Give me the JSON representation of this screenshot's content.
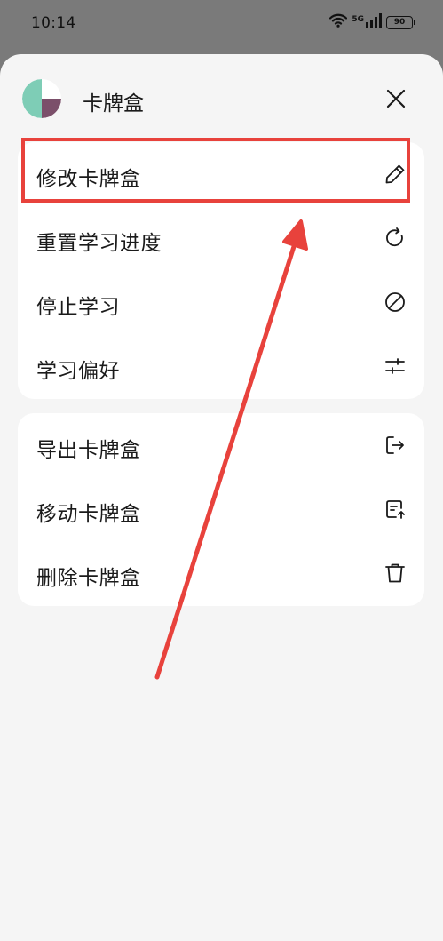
{
  "status_bar": {
    "time": "10:14",
    "network": "5G",
    "battery": "90"
  },
  "sheet": {
    "title": "卡牌盒",
    "avatar_colors": [
      "#7ecdb6",
      "#7b4f6a",
      "#ffffff"
    ]
  },
  "menu_group_1": [
    {
      "label": "修改卡牌盒",
      "icon": "pencil-icon"
    },
    {
      "label": "重置学习进度",
      "icon": "refresh-icon"
    },
    {
      "label": "停止学习",
      "icon": "stop-icon"
    },
    {
      "label": "学习偏好",
      "icon": "sliders-icon"
    }
  ],
  "menu_group_2": [
    {
      "label": "导出卡牌盒",
      "icon": "export-icon"
    },
    {
      "label": "移动卡牌盒",
      "icon": "move-icon"
    },
    {
      "label": "删除卡牌盒",
      "icon": "trash-icon"
    }
  ],
  "annotation": {
    "highlight_color": "#e8423c"
  }
}
